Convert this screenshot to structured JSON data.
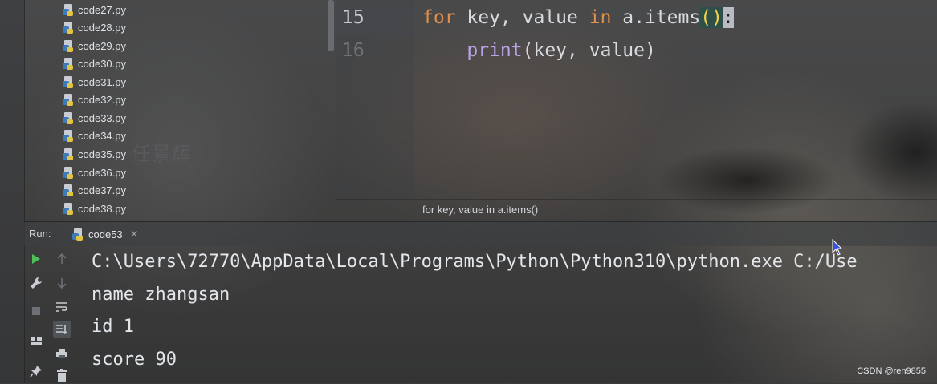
{
  "project_tree": {
    "files": [
      "code27.py",
      "code28.py",
      "code29.py",
      "code30.py",
      "code31.py",
      "code32.py",
      "code33.py",
      "code34.py",
      "code35.py",
      "code36.py",
      "code37.py",
      "code38.py"
    ],
    "watermark": "任景辉"
  },
  "editor": {
    "line_numbers": [
      "15",
      "16"
    ],
    "line15": {
      "kw_for": "for",
      "text1": " key, value ",
      "kw_in": "in",
      "text2": " a.items",
      "parens": "()",
      "colon": ":"
    },
    "line16": {
      "indent": "    ",
      "builtin": "print",
      "args": "(key, value)"
    },
    "breadcrumb": "for key, value in a.items()"
  },
  "run_panel": {
    "label": "Run:",
    "tab_label": "code53",
    "close_glyph": "×",
    "output": [
      "C:\\Users\\72770\\AppData\\Local\\Programs\\Python\\Python310\\python.exe C:/Use",
      "name zhangsan",
      "id 1",
      "score 90"
    ]
  },
  "watermark_corner": "CSDN @ren9855",
  "colors": {
    "keyword": "#e0904a",
    "builtin": "#b9a2e6",
    "run_green": "#4fbf5a",
    "text": "#e3e6ea"
  },
  "icons": [
    "python-file-icon",
    "run-icon",
    "wrench-icon",
    "stop-icon",
    "layout-icon",
    "pin-icon",
    "up-arrow-icon",
    "down-arrow-icon",
    "soft-wrap-icon",
    "scroll-to-end-icon",
    "print-icon",
    "trash-icon",
    "mouse-cursor-icon"
  ]
}
